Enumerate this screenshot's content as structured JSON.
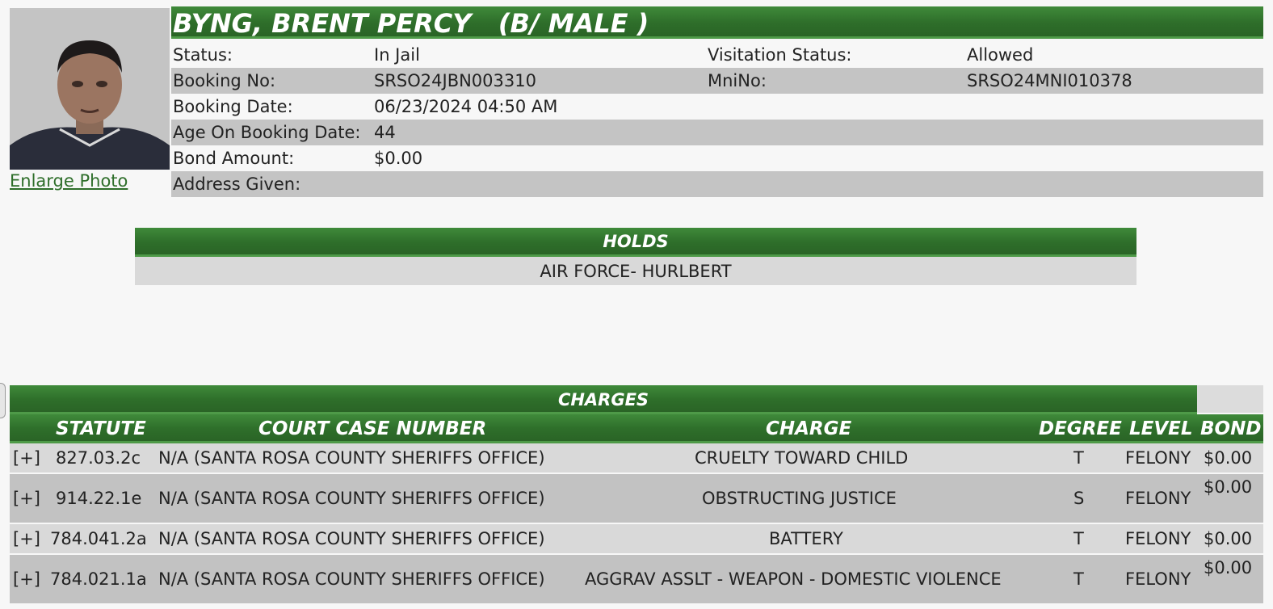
{
  "inmate": {
    "name_header": "BYNG, BRENT PERCY   (B/ MALE )",
    "enlarge_label": "Enlarge Photo"
  },
  "info": {
    "status_label": "Status:",
    "status_value": "In Jail",
    "visitation_label": "Visitation Status:",
    "visitation_value": "Allowed",
    "booking_no_label": "Booking No:",
    "booking_no_value": "SRSO24JBN003310",
    "mnino_label": "MniNo:",
    "mnino_value": "SRSO24MNI010378",
    "booking_date_label": "Booking Date:",
    "booking_date_value": "06/23/2024 04:50 AM",
    "age_label": "Age On Booking Date:",
    "age_value": "44",
    "bond_label": "Bond Amount:",
    "bond_value": "$0.00",
    "address_label": "Address Given:",
    "address_value": ""
  },
  "holds": {
    "title": "HOLDS",
    "items": [
      "AIR FORCE- HURLBERT"
    ]
  },
  "charges": {
    "title": "CHARGES",
    "headers": [
      "STATUTE",
      "COURT CASE NUMBER",
      "CHARGE",
      "DEGREE",
      "LEVEL",
      "BOND"
    ],
    "rows": [
      {
        "expand": "[+]",
        "statute": "827.03.2c",
        "court_case": "N/A (SANTA ROSA COUNTY SHERIFFS OFFICE)",
        "charge": "CRUELTY TOWARD CHILD",
        "degree": "T",
        "level": "FELONY",
        "bond": "$0.00"
      },
      {
        "expand": "[+]",
        "statute": "914.22.1e",
        "court_case": "N/A (SANTA ROSA COUNTY SHERIFFS OFFICE)",
        "charge": "OBSTRUCTING JUSTICE",
        "degree": "S",
        "level": "FELONY",
        "bond": "$0.00"
      },
      {
        "expand": "[+]",
        "statute": "784.041.2a",
        "court_case": "N/A (SANTA ROSA COUNTY SHERIFFS OFFICE)",
        "charge": "BATTERY",
        "degree": "T",
        "level": "FELONY",
        "bond": "$0.00"
      },
      {
        "expand": "[+]",
        "statute": "784.021.1a",
        "court_case": "N/A (SANTA ROSA COUNTY SHERIFFS OFFICE)",
        "charge": "AGGRAV ASSLT - WEAPON - DOMESTIC VIOLENCE",
        "degree": "T",
        "level": "FELONY",
        "bond": "$0.00"
      }
    ]
  }
}
